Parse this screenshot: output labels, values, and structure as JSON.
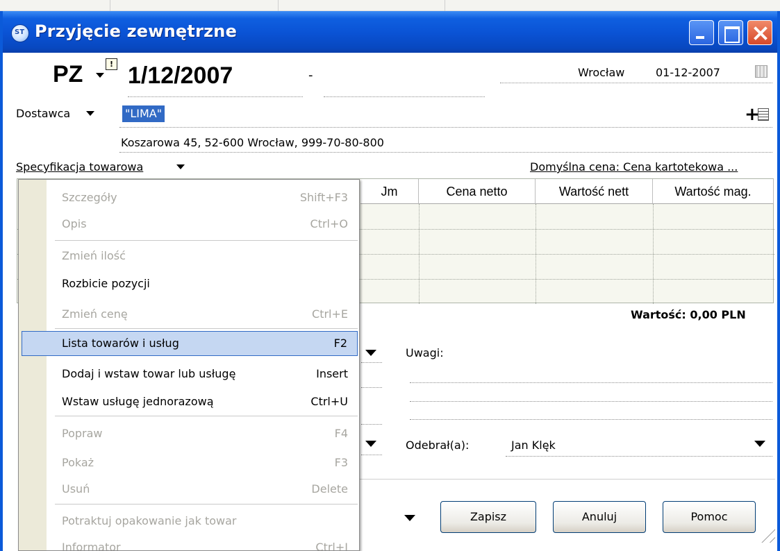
{
  "window": {
    "title": "Przyjęcie zewnętrzne"
  },
  "header": {
    "doc_type": "PZ",
    "doc_number": "1/12/2007",
    "dash": "-",
    "info_badge": "!",
    "city": "Wrocław",
    "date": "01-12-2007",
    "icons": [
      "calendar-icon",
      "info-icon"
    ]
  },
  "supplier": {
    "label": "Dostawca",
    "value": "\"LIMA\"",
    "address": "Koszarowa 45, 52-600 Wrocław, 999-70-80-800",
    "add_symbol": "+"
  },
  "spec": {
    "label": "Specyfikacja towarowa",
    "price_default": "Domyślna cena: Cena kartotekowa ..."
  },
  "grid": {
    "headers": [
      "Jm",
      "Cena netto",
      "Wartość nett",
      "Wartość mag."
    ],
    "rows": 4
  },
  "summary": {
    "total": "Wartość: 0,00 PLN"
  },
  "notes": {
    "label": "Uwagi:"
  },
  "receiver": {
    "label": "Odebrał(a):",
    "value": "Jan Klęk"
  },
  "buttons": {
    "save": "Zapisz",
    "cancel": "Anuluj",
    "help": "Pomoc"
  },
  "context_menu": {
    "items": [
      {
        "label": "Szczegóły",
        "shortcut": "Shift+F3",
        "enabled": false
      },
      {
        "label": "Opis",
        "shortcut": "Ctrl+O",
        "enabled": false
      },
      {
        "label": "Zmień ilość",
        "shortcut": "",
        "enabled": false
      },
      {
        "label": "Rozbicie pozycji",
        "shortcut": "",
        "enabled": true
      },
      {
        "label": "Zmień cenę",
        "shortcut": "Ctrl+E",
        "enabled": false
      },
      {
        "label": "Lista towarów i usług",
        "shortcut": "F2",
        "enabled": true,
        "highlighted": true
      },
      {
        "label": "Dodaj i wstaw towar lub usługę",
        "shortcut": "Insert",
        "enabled": true
      },
      {
        "label": "Wstaw usługę jednorazową",
        "shortcut": "Ctrl+U",
        "enabled": true
      },
      {
        "label": "Popraw",
        "shortcut": "F4",
        "enabled": false
      },
      {
        "label": "Pokaż",
        "shortcut": "F3",
        "enabled": false
      },
      {
        "label": "Usuń",
        "shortcut": "Delete",
        "enabled": false
      },
      {
        "label": "Potraktuj opakowanie jak towar",
        "shortcut": "",
        "enabled": false
      },
      {
        "label": "Informator",
        "shortcut": "Ctrl+I",
        "enabled": false
      }
    ]
  },
  "colors": {
    "titlebar": "#0a52d4",
    "menu_highlight": "#c5d7f2",
    "selection": "#316ac5",
    "disabled_text": "#a7a6a0"
  }
}
